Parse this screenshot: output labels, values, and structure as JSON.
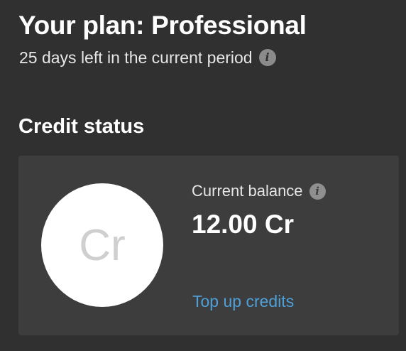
{
  "plan": {
    "title": "Your plan: Professional",
    "period_text": "25 days left in the current period",
    "info_icon": "info-icon"
  },
  "credit_status": {
    "title": "Credit status",
    "circle_label": "Cr",
    "balance_label": "Current balance",
    "balance_value": "12.00 Cr",
    "topup_label": "Top up credits",
    "link_color": "#4f9fd8"
  },
  "icons": {
    "info_glyph": "i"
  }
}
